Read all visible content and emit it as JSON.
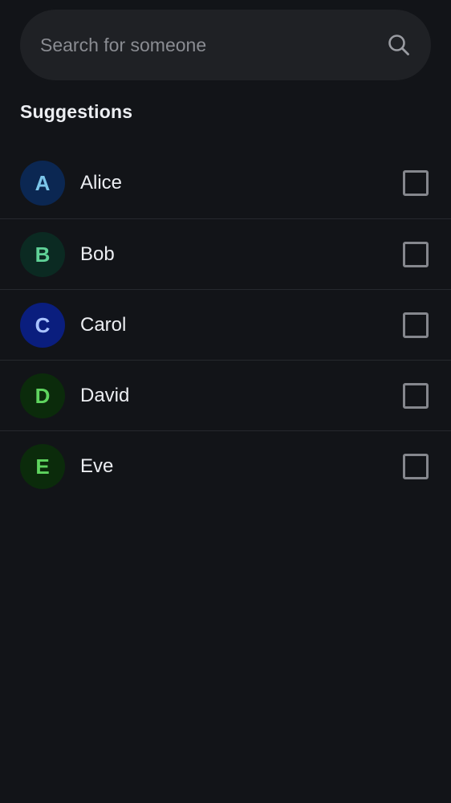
{
  "search": {
    "placeholder": "Search for someone",
    "value": "",
    "icon": "search-icon"
  },
  "suggestions": {
    "title": "Suggestions",
    "items": [
      {
        "initial": "A",
        "name": "Alice",
        "avatar_bg": "#0b2752",
        "avatar_fg": "#7cc6ea",
        "checked": false
      },
      {
        "initial": "B",
        "name": "Bob",
        "avatar_bg": "#0b2a22",
        "avatar_fg": "#5fd197",
        "checked": false
      },
      {
        "initial": "C",
        "name": "Carol",
        "avatar_bg": "#0a1e7e",
        "avatar_fg": "#a9c3ff",
        "checked": false
      },
      {
        "initial": "D",
        "name": "David",
        "avatar_bg": "#0b2b0b",
        "avatar_fg": "#5fd45f",
        "checked": false
      },
      {
        "initial": "E",
        "name": "Eve",
        "avatar_bg": "#0b2b0b",
        "avatar_fg": "#5fd45f",
        "checked": false
      }
    ]
  },
  "colors": {
    "background": "#121418",
    "search_bar": "#1f2125",
    "divider": "#26292e",
    "checkbox_border": "#85878d",
    "text_primary": "#eceef2",
    "text_placeholder": "#8a8c92"
  }
}
